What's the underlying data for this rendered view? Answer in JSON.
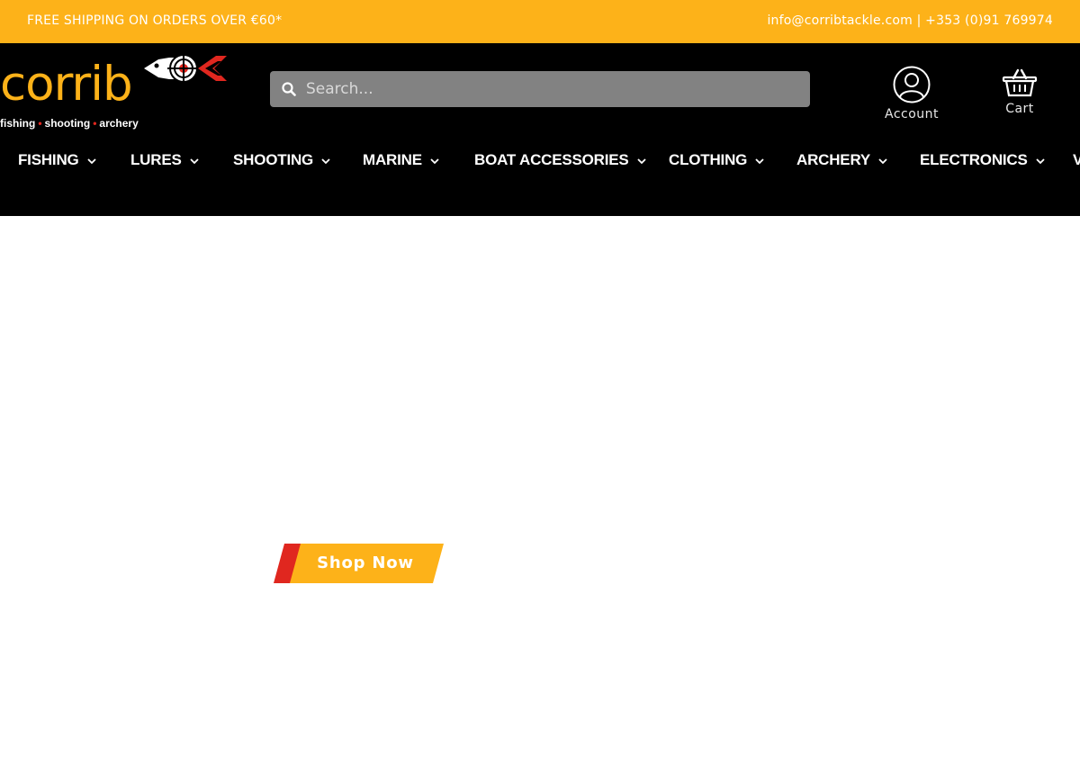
{
  "topbar": {
    "promo": "FREE SHIPPING ON ORDERS OVER €60*",
    "contact": "info@corribtackle.com | +353 (0)91 769974"
  },
  "logo": {
    "wordmark": "corrib",
    "tagline_1": "fishing",
    "tagline_2": "shooting",
    "tagline_3": "archery",
    "tagline_separator": "•"
  },
  "search": {
    "placeholder": "Search...",
    "icon": "search-icon"
  },
  "account": {
    "label": "Account",
    "icon": "user-icon"
  },
  "cart": {
    "label": "Cart",
    "icon": "basket-icon"
  },
  "nav": {
    "items": [
      {
        "label": "FISHING"
      },
      {
        "label": "LURES"
      },
      {
        "label": "SHOOTING"
      },
      {
        "label": "MARINE"
      },
      {
        "label": "BOAT ACCESSORIES"
      },
      {
        "label": "CLOTHING"
      },
      {
        "label": "ARCHERY"
      },
      {
        "label": "ELECTRONICS"
      },
      {
        "label": "V"
      }
    ]
  },
  "hero": {
    "cta_label": "Shop Now"
  },
  "colors": {
    "brand_yellow": "#fdb219",
    "brand_red": "#e0271f",
    "header_bg": "#000000",
    "search_bg": "#828282"
  }
}
